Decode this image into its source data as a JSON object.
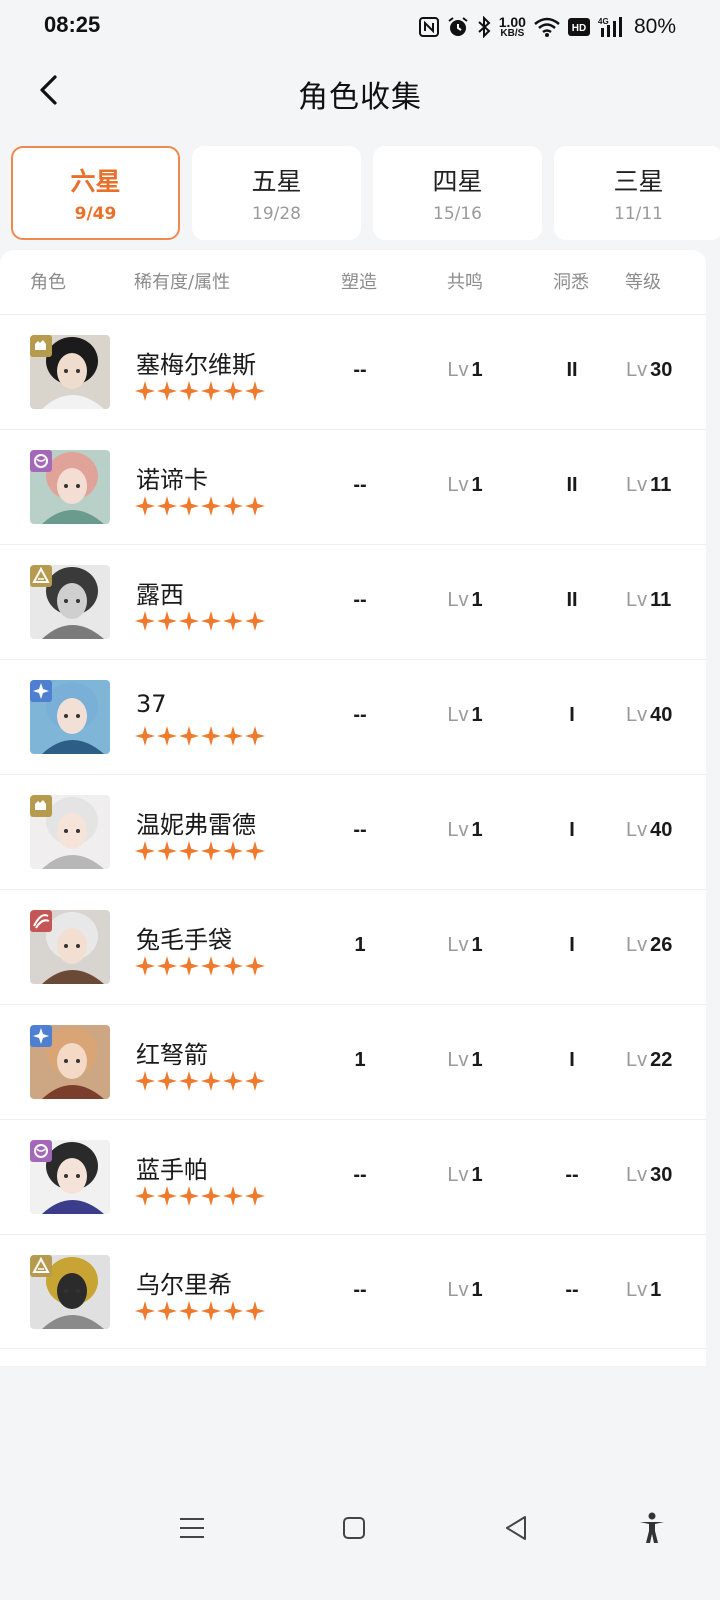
{
  "status": {
    "time": "08:25",
    "net_speed_value": "1.00",
    "net_speed_unit": "KB/S",
    "battery": "80%"
  },
  "header": {
    "title": "角色收集"
  },
  "tabs": [
    {
      "label": "六星",
      "count": "9/49",
      "active": true
    },
    {
      "label": "五星",
      "count": "19/28",
      "active": false
    },
    {
      "label": "四星",
      "count": "15/16",
      "active": false
    },
    {
      "label": "三星",
      "count": "11/11",
      "active": false
    }
  ],
  "columns": {
    "character": "角色",
    "rarity": "稀有度/属性",
    "reforge": "塑造",
    "resonance": "共鸣",
    "insight": "洞悉",
    "level": "等级"
  },
  "lv_prefix": "Lv",
  "star_count": 6,
  "colors": {
    "accent": "#e8702a",
    "star": "#ee7a2e",
    "attr_beast": "#b69a4e",
    "attr_spirit": "#a468b8",
    "attr_star": "#4f7fd0",
    "attr_plant": "#c45656"
  },
  "characters": [
    {
      "name": "塞梅尔维斯",
      "attr": "beast",
      "reforge": "--",
      "resonance": "1",
      "insight": "II",
      "level": "30"
    },
    {
      "name": "诺谛卡",
      "attr": "spirit",
      "reforge": "--",
      "resonance": "1",
      "insight": "II",
      "level": "11"
    },
    {
      "name": "露西",
      "attr": "mineral",
      "reforge": "--",
      "resonance": "1",
      "insight": "II",
      "level": "11"
    },
    {
      "name": "37",
      "attr": "star",
      "reforge": "--",
      "resonance": "1",
      "insight": "I",
      "level": "40"
    },
    {
      "name": "温妮弗雷德",
      "attr": "beast",
      "reforge": "--",
      "resonance": "1",
      "insight": "I",
      "level": "40"
    },
    {
      "name": "兔毛手袋",
      "attr": "plant",
      "reforge": "1",
      "resonance": "1",
      "insight": "I",
      "level": "26"
    },
    {
      "name": "红弩箭",
      "attr": "star",
      "reforge": "1",
      "resonance": "1",
      "insight": "I",
      "level": "22"
    },
    {
      "name": "蓝手帕",
      "attr": "spirit",
      "reforge": "--",
      "resonance": "1",
      "insight": "--",
      "level": "30"
    },
    {
      "name": "乌尔里希",
      "attr": "mineral",
      "reforge": "--",
      "resonance": "1",
      "insight": "--",
      "level": "1"
    }
  ]
}
